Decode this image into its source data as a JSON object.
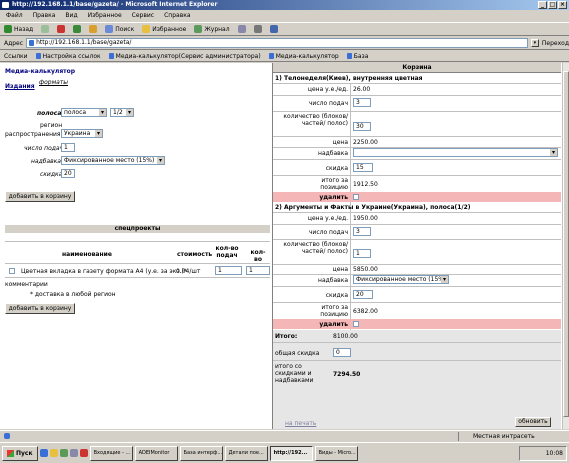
{
  "window": {
    "title": "http://192.168.1.1/base/gazeta/ - Microsoft Internet Explorer",
    "min": "_",
    "max": "□",
    "close": "×"
  },
  "menu": [
    "Файл",
    "Правка",
    "Вид",
    "Избранное",
    "Сервис",
    "Справка"
  ],
  "toolbar": {
    "back": "Назад",
    "search": "Поиск",
    "favorites": "Избранное",
    "journal": "Журнал"
  },
  "address": {
    "label": "Адрес",
    "url": "http://192.168.1.1/base/gazeta/",
    "go": "Переход"
  },
  "links": {
    "label": "Ссылки",
    "items": [
      "Настройка ссылок",
      "Медиа-калькулятор(Сервис администратора)",
      "Медиа-калькулятор",
      "База"
    ]
  },
  "left": {
    "title": "Медиа-калькулятор",
    "tab_izdaniya": "Издания",
    "tab_formats": "форматы",
    "polosa_label": "полоса",
    "polosa_value": "полоса",
    "polosa_size": "1/2",
    "region_label1": "регион",
    "region_label2": "распространения",
    "region_value": "Украина",
    "podach_label": "число подач",
    "podach_value": "1",
    "nadbavka_label": "надбавка",
    "nadbavka_value": "Фиксированное место (15%)",
    "skidka_label": "скидка",
    "skidka_value": "20",
    "add_btn": "добавить в корзину",
    "special_title": "спецпроекты",
    "sp_headers": [
      "наименование",
      "стоимость",
      "кол-во подач",
      "кол-во"
    ],
    "sp_row": {
      "name": "Цветная вкладка в газету формата А4 (у.е. за экз.)*",
      "price": "0.04/шт",
      "podach": "1",
      "qty": "1"
    },
    "comments": "комментарии",
    "footnote": "* доставка в любой регион",
    "add_btn2": "добавить в корзину"
  },
  "cart": {
    "title": "Корзина",
    "item1": {
      "header": "1) Телонеделя(Киев), внутренняя цветная",
      "price_unit_label": "цена у.е./ед.",
      "price_unit": "26.00",
      "podach_label": "число подач",
      "podach": "3",
      "qty_label": "количество (блоков/частей/ полос)",
      "qty": "30",
      "price_label": "цена",
      "price": "2250.00",
      "nadbavka_label": "надбавка",
      "nadbavka": "",
      "skidka_label": "скидка",
      "skidka": "15",
      "total_label": "итого за позицию",
      "total": "1912.50",
      "delete": "удалить"
    },
    "item2": {
      "header": "2) Аргументы и Факты в Украине(Украина), полоса(1/2)",
      "price_unit_label": "цена у.е./ед.",
      "price_unit": "1950.00",
      "podach_label": "число подач",
      "podach": "3",
      "qty_label": "количество (блоков/частей/ полос)",
      "qty": "1",
      "price_label": "цена",
      "price": "5850.00",
      "nadbavka_label": "надбавка",
      "nadbavka": "Фиксированное место (15%)",
      "skidka_label": "скидка",
      "skidka": "20",
      "total_label": "итого за позицию",
      "total": "6382.00",
      "delete": "удалить"
    },
    "itogo_label": "Итого:",
    "itogo": "8100.00",
    "general_skidka_label": "общая скидка",
    "general_skidka": "0",
    "final_label": "итого со скидками и надбавками",
    "final": "7294.50",
    "print_link": "на печать",
    "refresh_btn": "обновить"
  },
  "status": {
    "text": "",
    "zone": "Местная интрасеть"
  },
  "taskbar": {
    "start": "Пуск",
    "tasks": [
      "Входящие - ...",
      "ADEIMonitor",
      "База интерф...",
      "Детали пое...",
      "http://192...",
      "Виды - Micro..."
    ],
    "clock": "10:08"
  }
}
